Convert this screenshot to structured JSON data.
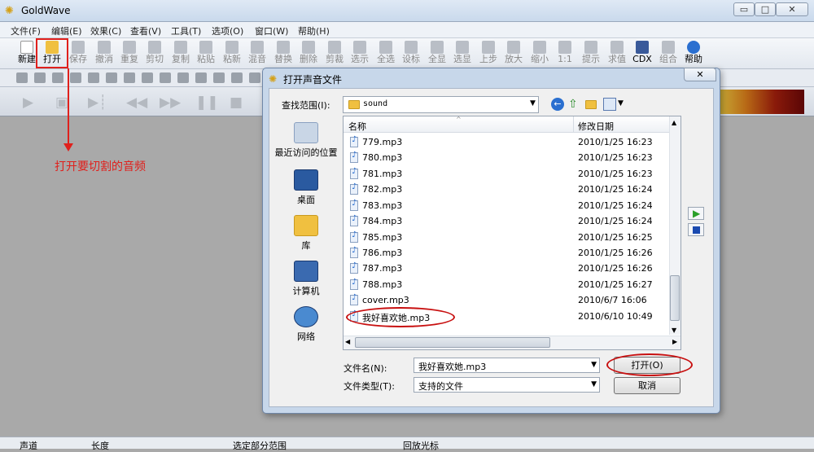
{
  "app": {
    "title": "GoldWave"
  },
  "window_buttons": [
    "▭",
    "□",
    "✕"
  ],
  "menu": [
    "文件(F)",
    "编辑(E)",
    "效果(C)",
    "查看(V)",
    "工具(T)",
    "选项(O)",
    "窗口(W)",
    "帮助(H)"
  ],
  "toolbar": [
    "新建",
    "打开",
    "保存",
    "撤消",
    "重复",
    "剪切",
    "复制",
    "粘贴",
    "粘新",
    "混音",
    "替换",
    "删除",
    "剪裁",
    "选示",
    "全选",
    "设标",
    "全显",
    "选显",
    "上步",
    "放大",
    "缩小",
    "1:1",
    "提示",
    "求值",
    "CDX",
    "组合",
    "帮助"
  ],
  "annotation": {
    "text": "打开要切割的音频"
  },
  "dialog": {
    "title": "打开声音文件",
    "close": "✕",
    "lookin_label": "查找范围(I):",
    "lookin_value": "sound",
    "places": [
      "最近访问的位置",
      "桌面",
      "库",
      "计算机",
      "网络"
    ],
    "columns": {
      "name": "名称",
      "date": "修改日期"
    },
    "files": [
      {
        "name": "779.mp3",
        "date": "2010/1/25 16:23"
      },
      {
        "name": "780.mp3",
        "date": "2010/1/25 16:23"
      },
      {
        "name": "781.mp3",
        "date": "2010/1/25 16:23"
      },
      {
        "name": "782.mp3",
        "date": "2010/1/25 16:24"
      },
      {
        "name": "783.mp3",
        "date": "2010/1/25 16:24"
      },
      {
        "name": "784.mp3",
        "date": "2010/1/25 16:24"
      },
      {
        "name": "785.mp3",
        "date": "2010/1/25 16:25"
      },
      {
        "name": "786.mp3",
        "date": "2010/1/25 16:26"
      },
      {
        "name": "787.mp3",
        "date": "2010/1/25 16:26"
      },
      {
        "name": "788.mp3",
        "date": "2010/1/25 16:27"
      },
      {
        "name": "cover.mp3",
        "date": "2010/6/7 16:06"
      },
      {
        "name": "我好喜欢她.mp3",
        "date": "2010/6/10 10:49"
      }
    ],
    "filename_label": "文件名(N):",
    "filename_value": "我好喜欢她.mp3",
    "filetype_label": "文件类型(T):",
    "filetype_value": "支持的文件",
    "open_button": "打开(O)",
    "cancel_button": "取消"
  },
  "statusbar": [
    "声道",
    "长度",
    "选定部分范围",
    "回放光标"
  ]
}
